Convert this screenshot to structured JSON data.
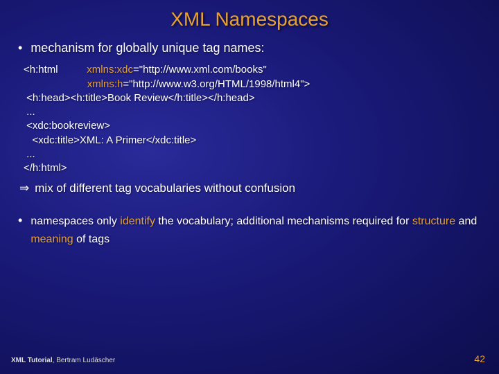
{
  "title": "XML Namespaces",
  "bullet1": "mechanism for globally unique tag names:",
  "code": {
    "l1a": "<h:html",
    "l1b": "xmlns:xdc",
    "l1c": "=\"http://www.xml.com/books\"",
    "l2a": "xmlns:h",
    "l2b": "=\"http://www.w3.org/HTML/1998/html4\">",
    "l3": " <h:head><h:title>Book Review</h:title></h:head>",
    "l4": " ...",
    "l5": " <xdc:bookreview>",
    "l6": "   <xdc:title>XML: A Primer</xdc:title>",
    "l7": " ...",
    "l8": "</h:html>"
  },
  "arrow": {
    "symbol": "⇒",
    "text": "mix of different tag vocabularies without confusion"
  },
  "bullet2": {
    "pre": "namespaces only ",
    "hl1": "identify",
    "mid1": " the vocabulary; additional mechanisms required for ",
    "hl2": "structure",
    "mid2": " and ",
    "hl3": "meaning",
    "post": " of tags"
  },
  "footer": {
    "bold": "XML Tutorial",
    "rest": ", Bertram Ludäscher"
  },
  "pagenum": "42"
}
